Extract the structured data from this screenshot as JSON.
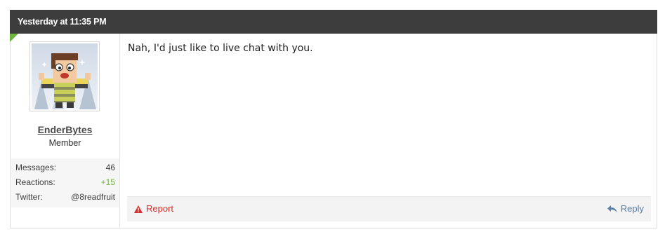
{
  "post": {
    "timestamp": "Yesterday at 11:35 PM",
    "message": "Nah, I'd just like to live chat with you."
  },
  "user": {
    "name": "EnderBytes",
    "title": "Member",
    "stats": [
      {
        "label": "Messages:",
        "value": "46"
      },
      {
        "label": "Reactions:",
        "value": "+15"
      },
      {
        "label": "Twitter:",
        "value": "@8readfruit"
      }
    ]
  },
  "actions": {
    "report_label": "Report",
    "reply_label": "Reply"
  },
  "colors": {
    "header_bg": "#3d3d3d",
    "accent_green": "#6cb33f",
    "report_red": "#d32f2f",
    "reply_blue": "#5a7fa6"
  },
  "icons": {
    "report": "warning-triangle-icon",
    "reply": "reply-arrow-icon"
  }
}
